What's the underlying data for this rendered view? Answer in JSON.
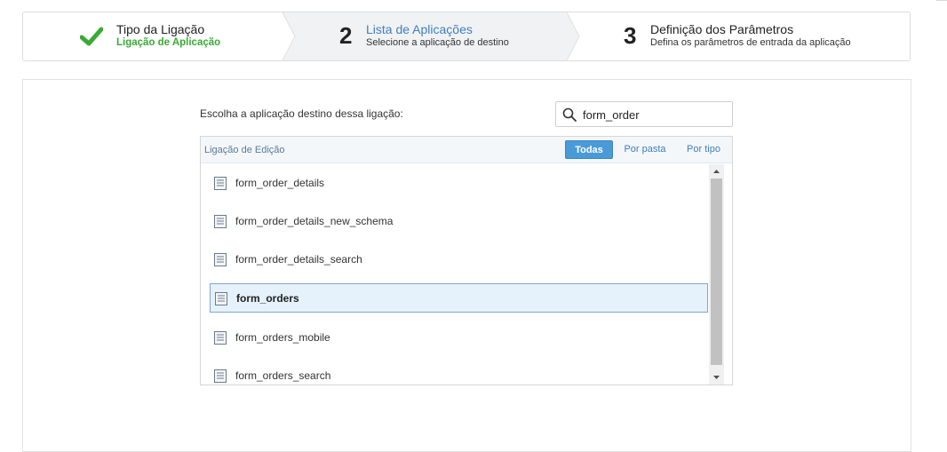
{
  "stepper": {
    "step1": {
      "title": "Tipo da Ligação",
      "subtitle": "Ligação de Aplicação",
      "status": "completed"
    },
    "step2": {
      "number": "2",
      "title": "Lista de Aplicações",
      "subtitle": "Selecione a aplicação de destino",
      "status": "active"
    },
    "step3": {
      "number": "3",
      "title": "Definição dos Parâmetros",
      "subtitle": "Defina os parâmetros de entrada da aplicação",
      "status": "pending"
    }
  },
  "main": {
    "prompt": "Escolha a aplicação destino dessa ligação:",
    "search": {
      "value": "form_order",
      "icon": "search-icon"
    },
    "list": {
      "header_title": "Ligação de Edição",
      "filters": [
        {
          "label": "Todas",
          "active": true
        },
        {
          "label": "Por pasta",
          "active": false
        },
        {
          "label": "Por tipo",
          "active": false
        }
      ],
      "items": [
        {
          "label": "form_order_details",
          "selected": false
        },
        {
          "label": "form_order_details_new_schema",
          "selected": false
        },
        {
          "label": "form_order_details_search",
          "selected": false
        },
        {
          "label": "form_orders",
          "selected": true
        },
        {
          "label": "form_orders_mobile",
          "selected": false
        },
        {
          "label": "form_orders_search",
          "selected": false
        }
      ]
    }
  },
  "colors": {
    "success": "#3aaa35",
    "active_step": "#3f7fbf",
    "filter_active": "#4a9ad8",
    "selected_row": "#e5f1fb"
  }
}
